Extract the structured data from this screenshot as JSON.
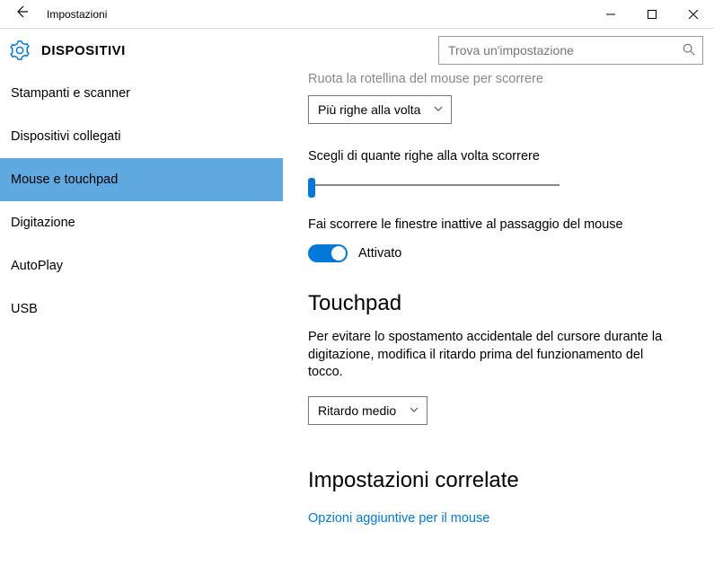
{
  "window": {
    "title": "Impostazioni",
    "category": "DISPOSITIVI"
  },
  "search": {
    "placeholder": "Trova un'impostazione"
  },
  "sidebar": {
    "items": [
      {
        "label": "Stampanti e scanner",
        "active": false
      },
      {
        "label": "Dispositivi collegati",
        "active": false
      },
      {
        "label": "Mouse e touchpad",
        "active": true
      },
      {
        "label": "Digitazione",
        "active": false
      },
      {
        "label": "AutoPlay",
        "active": false
      },
      {
        "label": "USB",
        "active": false
      }
    ]
  },
  "main": {
    "scroll_wheel_label": "Ruota la rotellina del mouse per scorrere",
    "scroll_wheel_dropdown": "Più righe alla volta",
    "lines_label": "Scegli di quante righe alla volta scorrere",
    "inactive_scroll_label": "Fai scorrere le finestre inattive al passaggio del mouse",
    "inactive_scroll_state": "Attivato",
    "touchpad_heading": "Touchpad",
    "touchpad_desc": "Per evitare lo spostamento accidentale del cursore durante la digitazione, modifica il ritardo prima del funzionamento del tocco.",
    "touchpad_delay_dropdown": "Ritardo medio",
    "related_heading": "Impostazioni correlate",
    "related_link": "Opzioni aggiuntive per il mouse"
  }
}
